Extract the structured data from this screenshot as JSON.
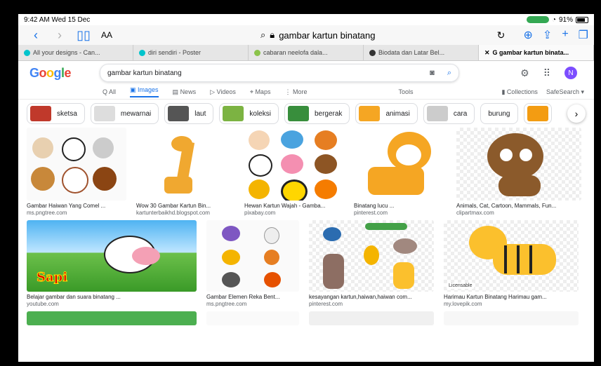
{
  "status": {
    "time": "9:42 AM  Wed 15 Dec",
    "battery": "91%"
  },
  "browser": {
    "aa": "AA",
    "address": "gambar kartun binatang"
  },
  "tabs": [
    {
      "label": "All your designs - Can...",
      "color": "#00c4cc"
    },
    {
      "label": "diri sendiri - Poster",
      "color": "#00c4cc"
    },
    {
      "label": "cabaran neelofa dala...",
      "color": "#8bc34a"
    },
    {
      "label": "Biodata dan Latar Bel...",
      "color": "#333333"
    },
    {
      "label": "G  gambar kartun binata...",
      "color": "#888888"
    }
  ],
  "google": {
    "logo": "Google",
    "query": "gambar kartun binatang",
    "avatar": "N",
    "nav": {
      "all": "Q  All",
      "images": "Images",
      "news": "News",
      "videos": "Videos",
      "maps": "Maps",
      "more": "⋮ More",
      "tools": "Tools",
      "collections": "Collections",
      "safesearch": "SafeSearch ▾"
    }
  },
  "chips": [
    {
      "label": "sketsa",
      "color": "#c0392b"
    },
    {
      "label": "mewarnai",
      "color": "#dddddd"
    },
    {
      "label": "laut",
      "color": "#555555"
    },
    {
      "label": "koleksi",
      "color": "#7cb342"
    },
    {
      "label": "bergerak",
      "color": "#388e3c"
    },
    {
      "label": "animasi",
      "color": "#f5a623"
    },
    {
      "label": "cara",
      "color": "#cccccc"
    },
    {
      "label": "burung",
      "color": ""
    },
    {
      "label": "",
      "color": "#f39c12"
    }
  ],
  "results": [
    {
      "title": "Gambar Haiwan Yang Comel ...",
      "source": "ms.pngtree.com",
      "badge": ""
    },
    {
      "title": "Wow 30 Gambar Kartun Bin...",
      "source": "kartunterbaikhd.blogspot.com",
      "badge": ""
    },
    {
      "title": "Hewan Kartun Wajah - Gamba...",
      "source": "pixabay.com",
      "badge": ""
    },
    {
      "title": "Binatang lucu ...",
      "source": "pinterest.com",
      "badge": ""
    },
    {
      "title": "Animals, Cat, Cartoon, Mammals, Fun...",
      "source": "clipartmax.com",
      "badge": ""
    },
    {
      "title": "Belajar gambar dan suara binatang ...",
      "source": "youtube.com",
      "badge": "",
      "overlay": "Sapi"
    },
    {
      "title": "Gambar Elemen Reka Bent...",
      "source": "ms.pngtree.com",
      "badge": ""
    },
    {
      "title": "kesayangan kartun,haiwan,haiwan com...",
      "source": "pinterest.com",
      "badge": ""
    },
    {
      "title": "Harimau Kartun Binatang Harimau gam...",
      "source": "my.lovepik.com",
      "badge": "Licensable"
    }
  ]
}
